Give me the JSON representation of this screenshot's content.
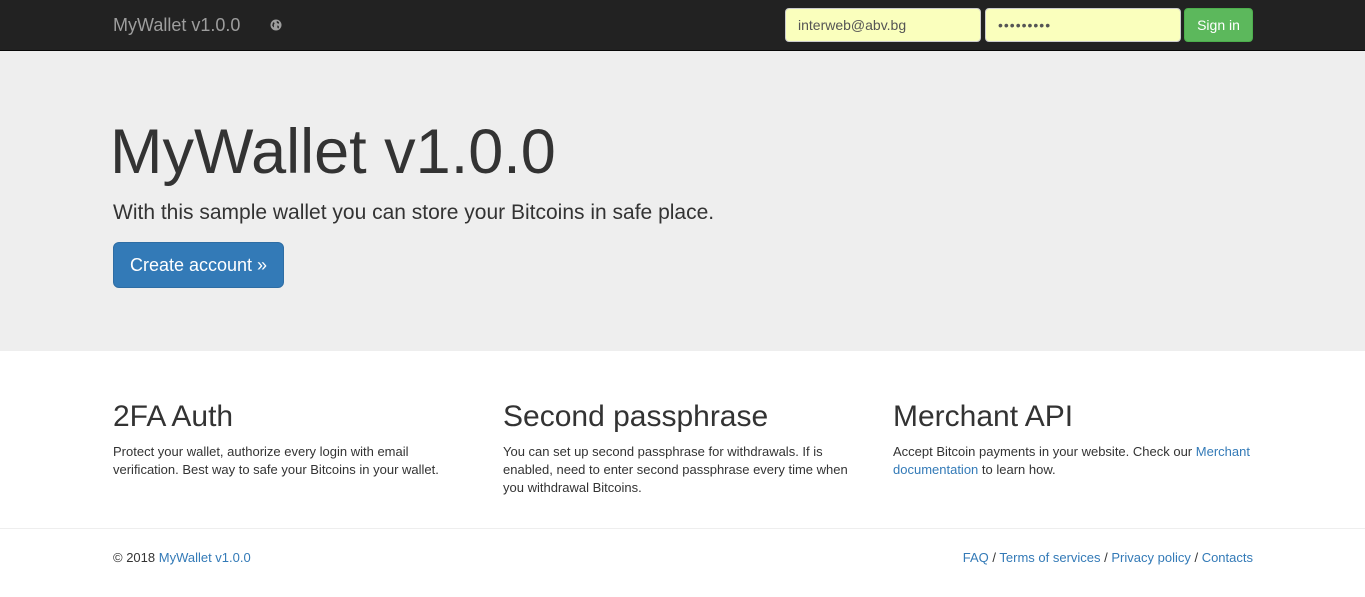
{
  "navbar": {
    "brand": "MyWallet v1.0.0",
    "globe_icon": "globe-icon",
    "email_value": "interweb@abv.bg",
    "password_value": "•••••••••",
    "signin_label": "Sign in"
  },
  "jumbotron": {
    "title": "MyWallet v1.0.0",
    "lead": "With this sample wallet you can store your Bitcoins in safe place.",
    "cta_label": "Create account »"
  },
  "features": [
    {
      "title": "2FA Auth",
      "text": "Protect your wallet, authorize every login with email verification. Best way to safe your Bitcoins in your wallet."
    },
    {
      "title": "Second passphrase",
      "text": "You can set up second passphrase for withdrawals. If is enabled, need to enter second passphrase every time when you withdrawal Bitcoins."
    },
    {
      "title": "Merchant API",
      "text_before": "Accept Bitcoin payments in your website. Check our ",
      "link": "Merchant documentation",
      "text_after": " to learn how."
    }
  ],
  "footer": {
    "copyright_prefix": "© 2018 ",
    "copyright_link": "MyWallet v1.0.0",
    "links": [
      "FAQ",
      "Terms of services",
      "Privacy policy",
      "Contacts"
    ],
    "separator": " / "
  },
  "colors": {
    "navbar_bg": "#222222",
    "autofill_bg": "#faffbd",
    "success": "#5cb85c",
    "primary": "#337ab7",
    "jumbotron_bg": "#eeeeee"
  }
}
